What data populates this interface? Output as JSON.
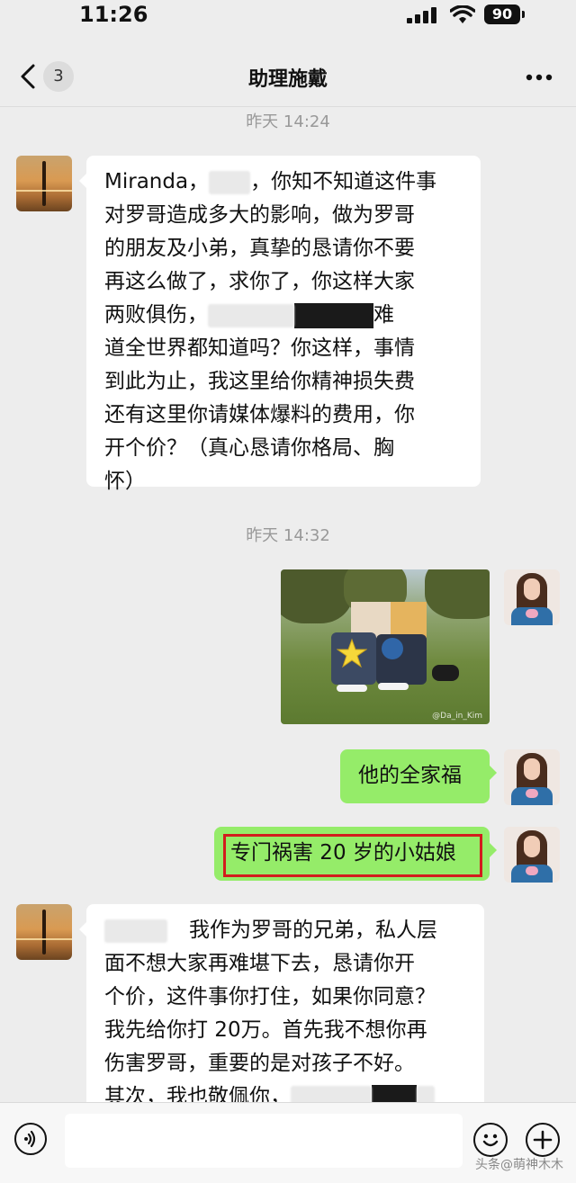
{
  "status_bar": {
    "time": "11:26",
    "battery": "90"
  },
  "nav": {
    "back_count": "3",
    "title": "助理施戴"
  },
  "chat": {
    "timestamps": [
      "昨天 14:24",
      "昨天 14:32"
    ],
    "msg1": {
      "lines": [
        [
          "Miranda，",
          "，你知不知道这件事"
        ],
        "对罗哥造成多大的影响，做为罗哥",
        "的朋友及小弟，真挚的恳请你不要",
        "再这么做了，求你了，你这样大家",
        [
          "两败俱伤，",
          "难"
        ],
        "道全世界都知道吗？你这样，事情",
        "到此为止，我这里给你精神损失费",
        "还有这里你请媒体爆料的费用，你",
        "开个价？（真心恳请你格局、胸",
        "怀）"
      ]
    },
    "photo": {
      "watermark": "@Da_in_Kim"
    },
    "msg2": {
      "text": "他的全家福"
    },
    "msg3": {
      "text": "专门祸害 20 岁的小姑娘"
    },
    "msg4": {
      "lines": [
        "我作为罗哥的兄弟，私人层",
        "面不想大家再难堪下去，恳请你开",
        "个价，这件事你打住，如果你同意？",
        "我先给你打 20万。首先我不想你再",
        "伤害罗哥，重要的是对孩子不好。",
        "其次，我也敬佩你，"
      ]
    }
  },
  "input_bar": {
    "placeholder": "",
    "watermark": "头条@萌神木木"
  },
  "colors": {
    "outgoing_bubble": "#95ec69",
    "incoming_bubble": "#ffffff",
    "background": "#ededed",
    "highlight": "#d21d1d"
  }
}
